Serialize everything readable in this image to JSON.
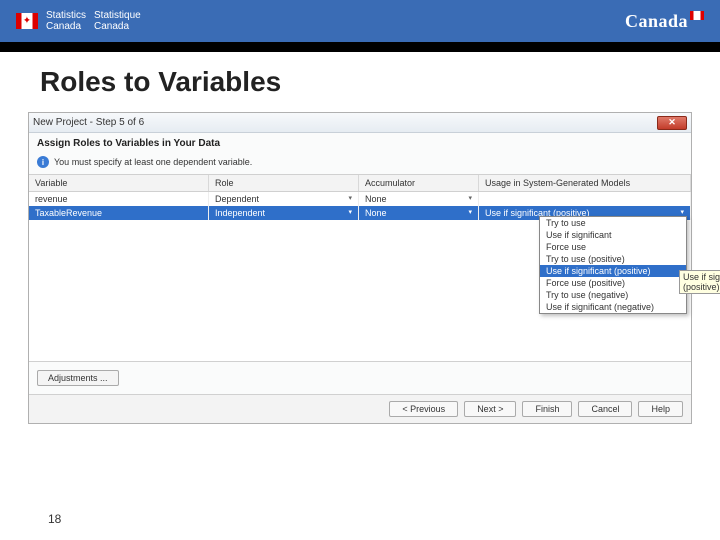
{
  "header": {
    "agency_en": "Statistics\nCanada",
    "agency_fr": "Statistique\nCanada",
    "wordmark": "Canada"
  },
  "slide": {
    "title": "Roles to Variables",
    "page_number": "18"
  },
  "dialog": {
    "title": "New Project - Step 5 of 6",
    "section_title": "Assign Roles to Variables in Your Data",
    "info_text": "You must specify at least one dependent variable.",
    "columns": {
      "variable": "Variable",
      "role": "Role",
      "accumulator": "Accumulator",
      "usage": "Usage in System-Generated Models"
    },
    "rows": [
      {
        "variable": "revenue",
        "role": "Dependent",
        "accumulator": "None",
        "usage": ""
      },
      {
        "variable": "TaxableRevenue",
        "role": "Independent",
        "accumulator": "None",
        "usage": "Use if significant (positive)"
      }
    ],
    "dropdown": {
      "items": [
        "Try to use",
        "Use if significant",
        "Force use",
        "Try to use (positive)",
        "Use if significant (positive)",
        "Force use (positive)",
        "Try to use (negative)",
        "Use if significant (negative)"
      ],
      "selected_index": 4
    },
    "tooltip": "Use if significant (positive)",
    "adjustments_label": "Adjustments ...",
    "buttons": {
      "previous": "< Previous",
      "next": "Next >",
      "finish": "Finish",
      "cancel": "Cancel",
      "help": "Help"
    }
  }
}
